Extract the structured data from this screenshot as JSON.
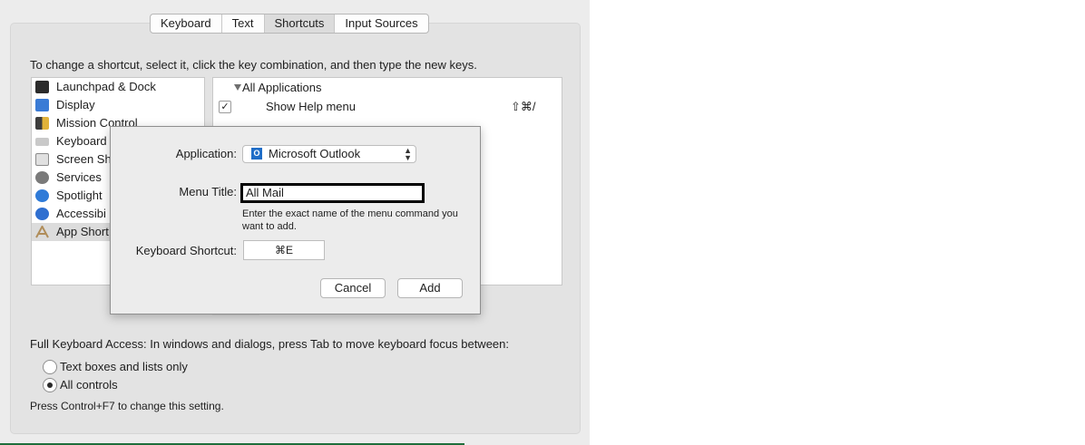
{
  "tabs": [
    "Keyboard",
    "Text",
    "Shortcuts",
    "Input Sources"
  ],
  "active_tab": "Shortcuts",
  "instruction": "To change a shortcut, select it, click the key combination, and then type the new keys.",
  "categories": [
    {
      "label": "Launchpad & Dock",
      "icon": "launchpad-dock-icon",
      "color": "#2b2b2b"
    },
    {
      "label": "Display",
      "icon": "display-icon",
      "color": "#3a7bd5"
    },
    {
      "label": "Mission Control",
      "icon": "mission-control-icon",
      "color": "#3d3d3d"
    },
    {
      "label": "Keyboard",
      "icon": "keyboard-icon",
      "color": "#c9c9c9"
    },
    {
      "label": "Screen Sh",
      "icon": "screenshot-icon",
      "color": "#8b8b8b"
    },
    {
      "label": "Services",
      "icon": "gear-icon",
      "color": "#7a7a7a"
    },
    {
      "label": "Spotlight",
      "icon": "spotlight-icon",
      "color": "#2f7bd8"
    },
    {
      "label": "Accessibi",
      "icon": "accessibility-icon",
      "color": "#2f6fd0"
    },
    {
      "label": "App Short",
      "icon": "app-shortcuts-icon",
      "color": "#b08d5a"
    }
  ],
  "shortcut_group": "All Applications",
  "shortcut_item": {
    "label": "Show Help menu",
    "keys": "⇧⌘/",
    "checked": "✓"
  },
  "dialog": {
    "application_label": "Application:",
    "application_value": "Microsoft Outlook",
    "application_icon_letter": "O",
    "menu_title_label": "Menu Title:",
    "menu_title_value": "All Mail",
    "hint": "Enter the exact name of the menu command you want to add.",
    "keyboard_shortcut_label": "Keyboard Shortcut:",
    "keyboard_shortcut_value": "⌘E",
    "cancel": "Cancel",
    "add": "Add"
  },
  "full_keyboard_access": "Full Keyboard Access: In windows and dialogs, press Tab to move keyboard focus between:",
  "radio_options": [
    "Text boxes and lists only",
    "All controls"
  ],
  "radio_selected": "All controls",
  "note": "Press Control+F7 to change this setting."
}
